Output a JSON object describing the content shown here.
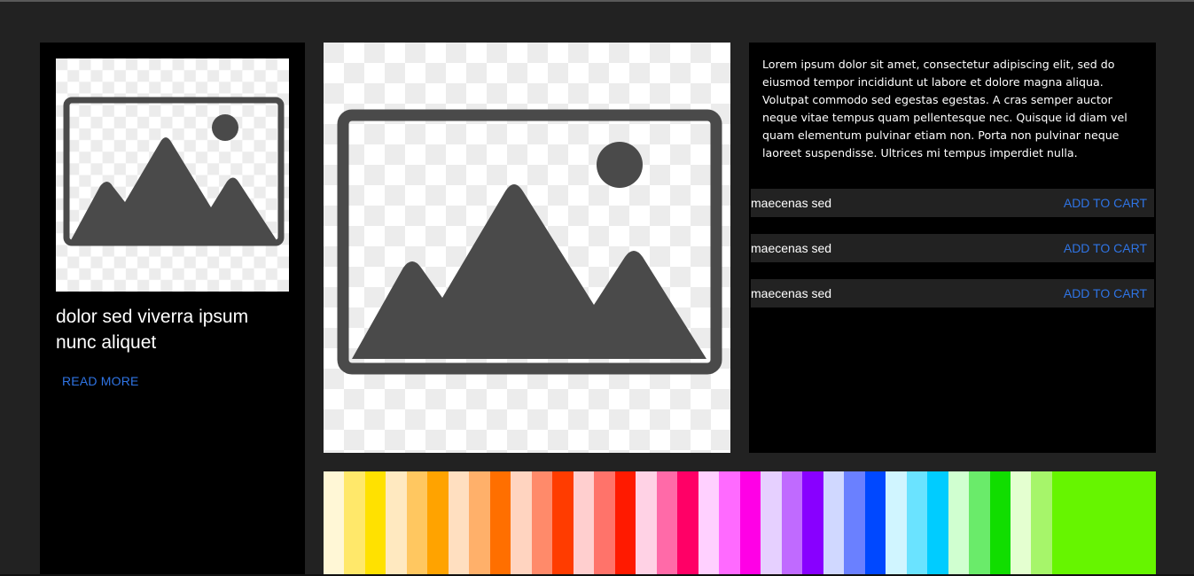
{
  "left_card": {
    "image_icon": "image-placeholder-icon",
    "title": "dolor sed viverra ipsum nunc aliquet",
    "link": "READ MORE"
  },
  "hero": {
    "image_icon": "image-placeholder-icon"
  },
  "right_panel": {
    "description": "Lorem ipsum dolor sit amet, consectetur adipiscing elit, sed do eiusmod tempor incididunt ut labore et dolore magna aliqua. Volutpat commodo sed egestas egestas. A cras semper auctor neque vitae tempus quam pellentesque nec. Quisque id diam vel quam elementum pulvinar etiam non. Porta non pulvinar neque laoreet suspendisse. Ultrices mi tempus imperdiet nulla.",
    "items": [
      {
        "name": "maecenas sed",
        "action": "ADD TO CART"
      },
      {
        "name": "maecenas sed",
        "action": "ADD TO CART"
      },
      {
        "name": "maecenas sed",
        "action": "ADD TO CART"
      }
    ]
  },
  "colors": {
    "background": "#222222",
    "panel": "#000000",
    "link": "#2f74e4",
    "swatches": [
      "#fff7d6",
      "#ffe86a",
      "#ffe100",
      "#ffe9c0",
      "#ffc760",
      "#ffa300",
      "#ffdfc0",
      "#ffb06a",
      "#ff6f00",
      "#ffd4c0",
      "#ff8a6a",
      "#ff3c00",
      "#ffcfcf",
      "#ff736a",
      "#ff1a00",
      "#ffd2e5",
      "#ff6aa8",
      "#ff0066",
      "#ffd0ff",
      "#ff6aff",
      "#ff00e6",
      "#e6d0ff",
      "#c06aff",
      "#8800ff",
      "#d0d8ff",
      "#6a80ff",
      "#0048ff",
      "#d0f5ff",
      "#6ae3ff",
      "#00ccff",
      "#d0ffd0",
      "#6aeb6a",
      "#11dd00",
      "#e4ffd0",
      "#a6f56a",
      "#66f500"
    ]
  }
}
